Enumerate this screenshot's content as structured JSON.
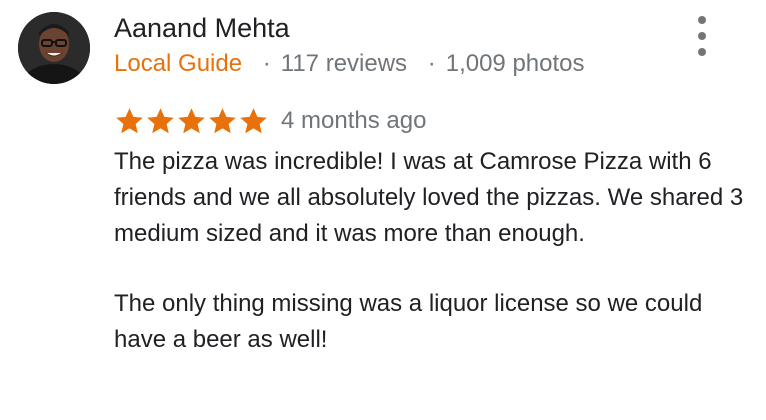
{
  "review": {
    "author_name": "Aanand Mehta",
    "guide_label": "Local Guide",
    "review_count": "117 reviews",
    "photo_count": "1,009 photos",
    "separator": "·",
    "rating": 5,
    "rating_max": 5,
    "time_ago": "4 months ago",
    "paragraphs": [
      "The pizza was incredible! I was at Camrose Pizza with 6 friends and we all absolutely loved the pizzas. We shared 3 medium sized and it was more than enough.",
      "The only thing missing was a liquor license so we could have a beer as well!"
    ]
  },
  "colors": {
    "star": "#e8710a",
    "guide": "#e8710a",
    "secondary_text": "#70757a",
    "primary_text": "#202124"
  },
  "icons": {
    "more": "more-vert-icon",
    "star": "star-icon"
  }
}
